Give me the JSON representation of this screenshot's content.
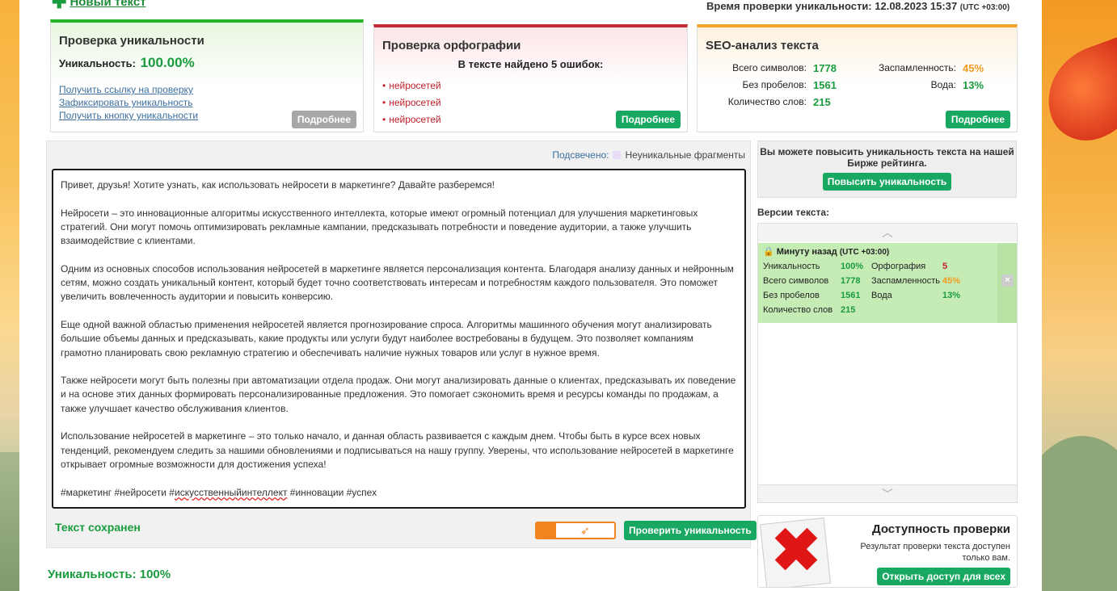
{
  "header": {
    "new_text": "Новый текст",
    "check_time_label": "Время проверки уникальности: 12.08.2023 15:37",
    "check_time_tz": "(UTC +03:00)"
  },
  "uniqueness_card": {
    "title": "Проверка уникальности",
    "uniq_label": "Уникальность:",
    "uniq_value": "100.00%",
    "links": [
      "Получить ссылку на проверку",
      "Зафиксировать уникальность",
      "Получить кнопку уникальности"
    ],
    "more": "Подробнее"
  },
  "spelling_card": {
    "title": "Проверка орфографии",
    "found": "В тексте найдено 5 ошибок:",
    "errors": [
      "нейросетей",
      "нейросетей",
      "нейросетей"
    ],
    "more": "Подробнее"
  },
  "seo_card": {
    "title": "SEO-анализ текста",
    "chars_label": "Всего символов:",
    "chars": "1778",
    "nospace_label": "Без пробелов:",
    "nospace": "1561",
    "words_label": "Количество слов:",
    "words": "215",
    "spam_label": "Заспамленность:",
    "spam": "45%",
    "water_label": "Вода:",
    "water": "13%",
    "more": "Подробнее"
  },
  "editor": {
    "highlight_label": "Подсвечено:",
    "highlight_legend": "Неуникальные фрагменты",
    "paragraphs": [
      "Привет, друзья! Хотите узнать, как использовать нейросети в маркетинге?  Давайте разберемся!",
      "Нейросети – это инновационные алгоритмы искусственного интеллекта, которые имеют огромный потенциал для улучшения маркетинговых стратегий. Они могут помочь оптимизировать рекламные кампании, предсказывать потребности и поведение аудитории, а также улучшить взаимодействие с клиентами.",
      "Одним из основных способов использования нейросетей в маркетинге является персонализация контента. Благодаря анализу данных и нейронным сетям, можно создать уникальный контент, который будет точно соответствовать интересам и потребностям каждого пользователя. Это поможет увеличить вовлеченность аудитории и повысить конверсию.",
      "Еще одной важной областью применения нейросетей является прогнозирование спроса. Алгоритмы машинного обучения могут анализировать большие объемы данных и предсказывать, какие продукты или услуги будут наиболее востребованы в будущем. Это позволяет компаниям грамотно планировать свою рекламную стратегию и обеспечивать наличие нужных товаров или услуг в нужное время.",
      "Также нейросети могут быть полезны при автоматизации отдела продаж. Они могут анализировать данные о клиентах, предсказывать их поведение и на основе этих данных формировать персонализированные предложения. Это помогает сэкономить время и ресурсы команды по продажам, а также улучшает качество обслуживания клиентов.",
      "Использование нейросетей в маркетинге – это только начало, и данная область развивается с каждым днем. Чтобы быть в курсе всех новых тенденций, рекомендуем следить за нашими обновлениями и подписываться на нашу группу. Уверены, что использование нейросетей в маркетинге открывает огромные возможности для достижения успеха!"
    ],
    "tags_a": "#маркетинг #нейросети #",
    "tags_b": "искусственныйинтеллект",
    "tags_c": " #инновации #успех",
    "saved": "Текст сохранен",
    "check_button": "Проверить уникальность"
  },
  "result": "Уникальность: 100%",
  "promo": {
    "text": "Вы можете повысить уникальность текста на нашей Бирже рейтинга.",
    "button": "Повысить уникальность"
  },
  "versions": {
    "title": "Версии текста:",
    "item": {
      "time": "Минуту назад",
      "tz": "(UTC +03:00)",
      "uniq_label": "Уникальность",
      "uniq": "100%",
      "spell_label": "Орфография",
      "spell": "5",
      "chars_label": "Всего символов",
      "chars": "1778",
      "spam_label": "Заспамленность",
      "spam": "45%",
      "nospace_label": "Без пробелов",
      "nospace": "1561",
      "water_label": "Вода",
      "water": "13%",
      "words_label": "Количество слов",
      "words": "215"
    }
  },
  "access": {
    "title": "Доступность проверки",
    "desc": "Результат проверки текста доступен только вам.",
    "button": "Открыть доступ для всех"
  }
}
